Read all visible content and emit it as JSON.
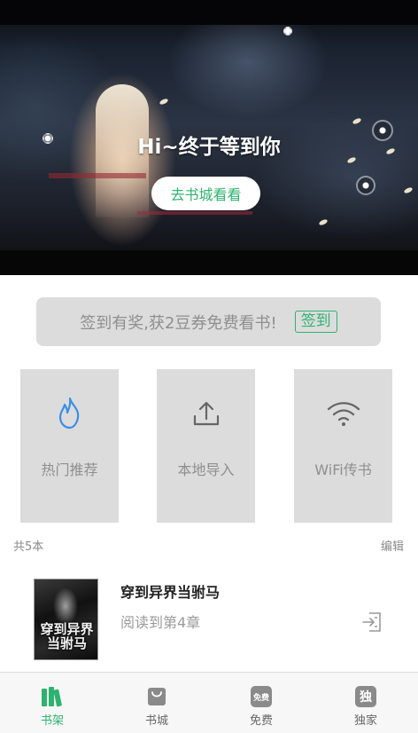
{
  "hero": {
    "title": "Hi~终于等到你",
    "button_label": "去书城看看"
  },
  "signin": {
    "text": "签到有奖,获2豆券免费看书!",
    "button_label": "签到"
  },
  "tiles": [
    {
      "label": "热门推荐",
      "icon": "flame-icon"
    },
    {
      "label": "本地导入",
      "icon": "upload-icon"
    },
    {
      "label": "WiFi传书",
      "icon": "wifi-icon"
    }
  ],
  "shelf": {
    "count_label": "共5本",
    "edit_label": "编辑"
  },
  "book": {
    "title": "穿到异界当驸马",
    "progress": "阅读到第4章",
    "cover_title": "穿到异界当驸马"
  },
  "nav": [
    {
      "label": "书架",
      "icon": "bookshelf-icon",
      "active": true
    },
    {
      "label": "书城",
      "icon": "shopping-bag-icon",
      "active": false
    },
    {
      "label": "免费",
      "icon": "free-icon",
      "badge_text": "免费",
      "active": false
    },
    {
      "label": "独家",
      "icon": "exclusive-icon",
      "badge_text": "独",
      "active": false
    }
  ],
  "colors": {
    "accent": "#2db36f",
    "tile_bg": "#dcdcdc",
    "muted_text": "#8f8f8f",
    "icon_blue": "#3a8ee6"
  }
}
